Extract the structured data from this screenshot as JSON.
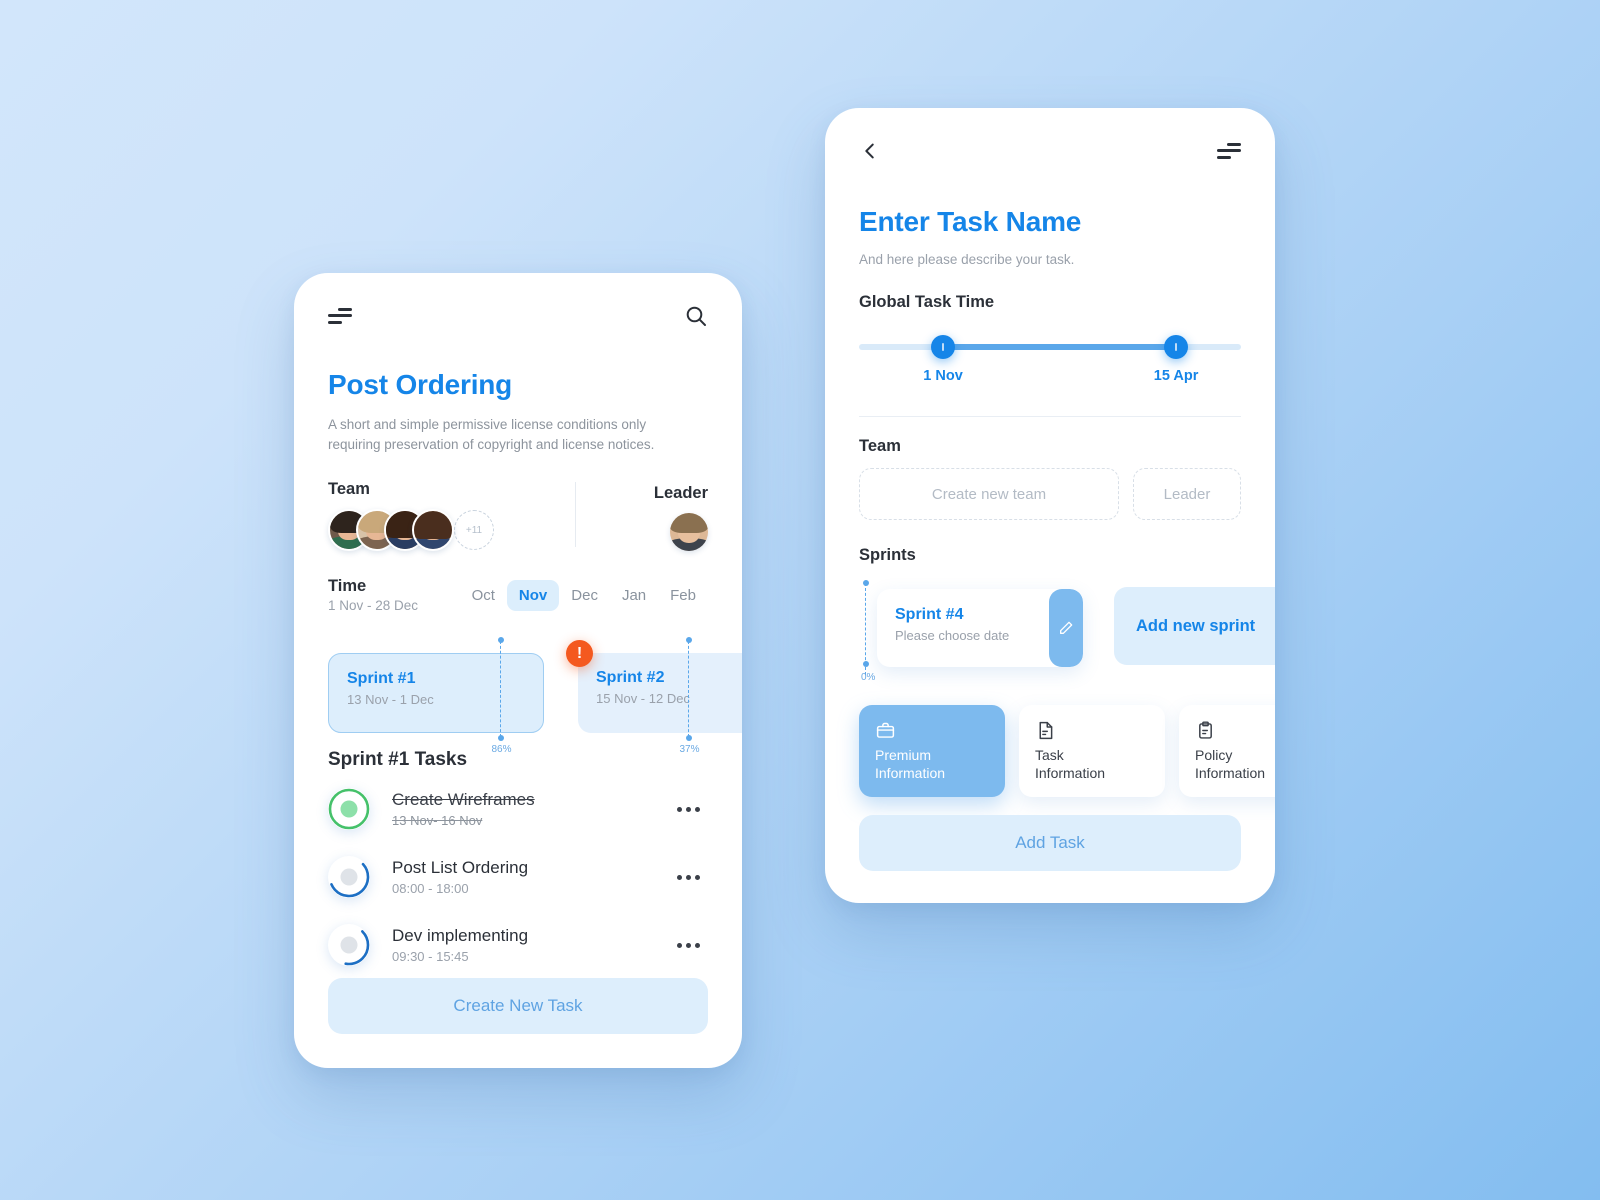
{
  "background": {
    "from": "#cde4fa",
    "to": "#85bef0"
  },
  "accent": {
    "blue": "#1585e8",
    "light_blue": "#ddeefc",
    "orange": "#f4591f",
    "green": "#45c16a"
  },
  "left_phone": {
    "topbar": {
      "menu_icon": "filter-menu-icon",
      "search_icon": "search-icon"
    },
    "title": "Post Ordering",
    "description": "A short and simple permissive license conditions only requiring preservation of copyright and license notices.",
    "team": {
      "label": "Team",
      "more_count": "+11"
    },
    "leader": {
      "label": "Leader"
    },
    "time": {
      "label": "Time",
      "range": "1 Nov - 28 Dec"
    },
    "months": [
      {
        "label": "Oct",
        "active": false
      },
      {
        "label": "Nov",
        "active": true
      },
      {
        "label": "Dec",
        "active": false
      },
      {
        "label": "Jan",
        "active": false
      },
      {
        "label": "Feb",
        "active": false
      }
    ],
    "sprints": [
      {
        "name": "Sprint #1",
        "dates": "13 Nov - 1 Dec",
        "progress": "86%",
        "alert": false
      },
      {
        "name": "Sprint #2",
        "dates": "15 Nov - 12 Dec",
        "progress": "37%",
        "alert": true,
        "alert_glyph": "!"
      }
    ],
    "tasks_section_title": "Sprint #1 Tasks",
    "tasks": [
      {
        "name": "Create Wireframes",
        "time": "13 Nov- 16 Nov",
        "state": "done",
        "ring_pct": 100
      },
      {
        "name": "Post List Ordering",
        "time": "08:00 - 18:00",
        "state": "active",
        "ring_pct": 55
      },
      {
        "name": "Dev implementing",
        "time": "09:30 - 15:45",
        "state": "active",
        "ring_pct": 40
      }
    ],
    "primary_button": "Create New Task"
  },
  "right_phone": {
    "topbar": {
      "back_icon": "chevron-left-icon",
      "menu_icon": "filter-menu-icon"
    },
    "title": "Enter Task Name",
    "subtitle": "And here please describe your task.",
    "global_task_time": {
      "label": "Global Task Time",
      "start": "1 Nov",
      "end": "15 Apr"
    },
    "team": {
      "label": "Team",
      "create_team_placeholder": "Create new team",
      "leader_placeholder": "Leader"
    },
    "sprints": {
      "label": "Sprints",
      "card": {
        "name": "Sprint #4",
        "dates": "Please choose date",
        "progress": "0%",
        "edit_icon": "pencil-icon"
      },
      "add_label": "Add new sprint"
    },
    "info_cards": [
      {
        "label": "Premium\nInformation",
        "line1": "Premium",
        "line2": "Information",
        "icon": "briefcase-icon",
        "active": true
      },
      {
        "label": "Task Information",
        "line1": "Task",
        "line2": "Information",
        "icon": "document-icon",
        "active": false
      },
      {
        "label": "Policy Information",
        "line1": "Policy",
        "line2": "Information",
        "icon": "clipboard-icon",
        "active": false
      }
    ],
    "primary_button": "Add Task"
  }
}
